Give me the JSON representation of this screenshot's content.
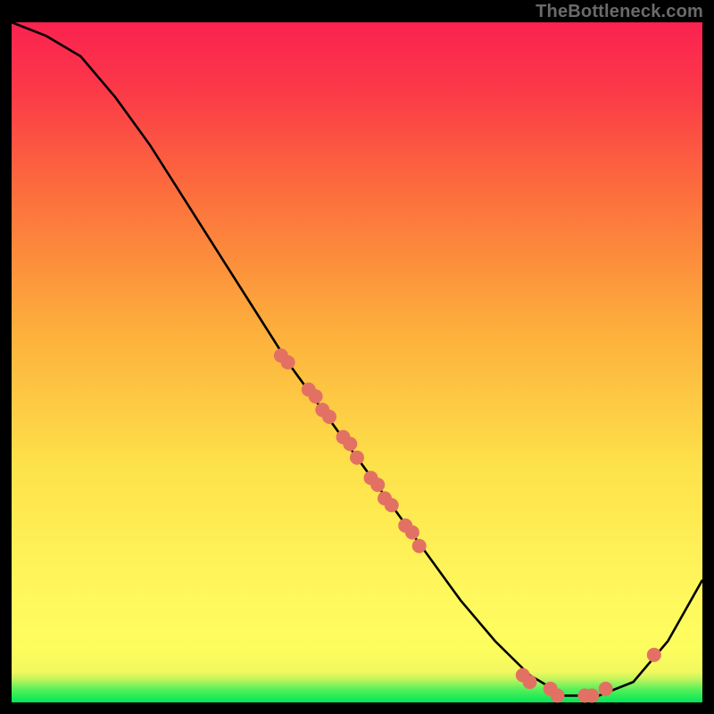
{
  "watermark": "TheBottleneck.com",
  "chart_data": {
    "type": "line",
    "title": "",
    "xlabel": "",
    "ylabel": "",
    "xlim": [
      0,
      100
    ],
    "ylim": [
      0,
      100
    ],
    "series": [
      {
        "name": "curve",
        "x": [
          0,
          5,
          10,
          15,
          20,
          25,
          30,
          35,
          40,
          45,
          50,
          55,
          60,
          65,
          70,
          75,
          80,
          85,
          90,
          95,
          100
        ],
        "y": [
          100,
          98,
          95,
          89,
          82,
          74,
          66,
          58,
          50,
          43,
          36,
          29,
          22,
          15,
          9,
          4,
          1,
          1,
          3,
          9,
          18
        ]
      }
    ],
    "markers": [
      {
        "x": 39,
        "y": 51
      },
      {
        "x": 40,
        "y": 50
      },
      {
        "x": 43,
        "y": 46
      },
      {
        "x": 44,
        "y": 45
      },
      {
        "x": 45,
        "y": 43
      },
      {
        "x": 46,
        "y": 42
      },
      {
        "x": 48,
        "y": 39
      },
      {
        "x": 49,
        "y": 38
      },
      {
        "x": 50,
        "y": 36
      },
      {
        "x": 52,
        "y": 33
      },
      {
        "x": 53,
        "y": 32
      },
      {
        "x": 54,
        "y": 30
      },
      {
        "x": 55,
        "y": 29
      },
      {
        "x": 57,
        "y": 26
      },
      {
        "x": 58,
        "y": 25
      },
      {
        "x": 59,
        "y": 23
      },
      {
        "x": 74,
        "y": 4
      },
      {
        "x": 75,
        "y": 3
      },
      {
        "x": 78,
        "y": 2
      },
      {
        "x": 79,
        "y": 1
      },
      {
        "x": 83,
        "y": 1
      },
      {
        "x": 84,
        "y": 1
      },
      {
        "x": 86,
        "y": 2
      },
      {
        "x": 93,
        "y": 7
      }
    ],
    "marker_color": "#e37163",
    "curve_color": "#000000"
  }
}
